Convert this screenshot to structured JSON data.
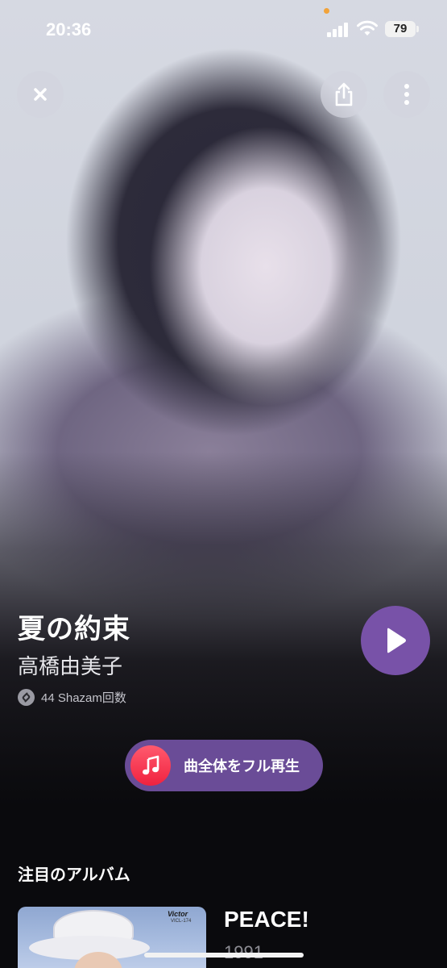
{
  "status_bar": {
    "time": "20:36",
    "battery": "79"
  },
  "header": {
    "close_icon": "close-icon",
    "share_icon": "share-icon",
    "more_icon": "more-vertical-icon"
  },
  "song": {
    "title": "夏の約束",
    "artist": "高橋由美子",
    "shazam_count": "44 Shazam回数"
  },
  "actions": {
    "full_play_label": "曲全体をフル再生"
  },
  "featured_album": {
    "section_title": "注目のアルバム",
    "album_name": "PEACE!",
    "year": "1991",
    "label_logo": "Victor",
    "catalog": "VICL-174"
  },
  "colors": {
    "accent_purple": "#7852a8",
    "full_play_bg": "#6a4c97",
    "apple_music_red": "#f0223f"
  }
}
